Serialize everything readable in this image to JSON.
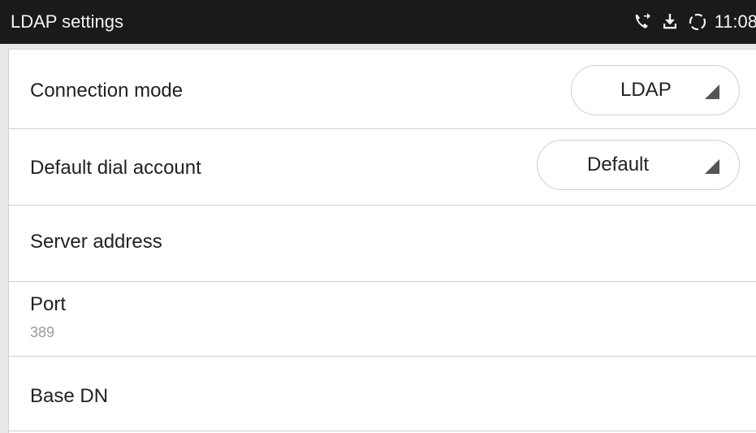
{
  "statusbar": {
    "title": "LDAP settings",
    "time": "11:08",
    "icons": [
      "call-forward-icon",
      "download-icon",
      "sync-icon"
    ]
  },
  "settings": {
    "connection_mode": {
      "label": "Connection mode",
      "value": "LDAP"
    },
    "default_dial_account": {
      "label": "Default dial account",
      "value": "Default"
    },
    "server_address": {
      "label": "Server address"
    },
    "port": {
      "label": "Port",
      "value": "389"
    },
    "base_dn": {
      "label": "Base DN"
    }
  },
  "colors": {
    "statusbar_bg": "#1a1a1a",
    "background": "#ffffff",
    "divider": "#cfcfcf",
    "text": "#222222",
    "subtext": "#9b9b9b"
  }
}
